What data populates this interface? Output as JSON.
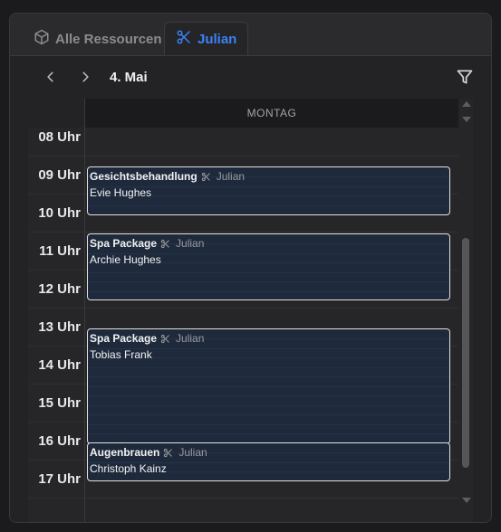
{
  "tabs": [
    {
      "label": "Alle Ressourcen",
      "icon": "cube-icon",
      "active": false
    },
    {
      "label": "Julian",
      "icon": "scissors-icon",
      "active": true
    }
  ],
  "toolbar": {
    "prev_icon": "chevron-left-icon",
    "next_icon": "chevron-right-icon",
    "date": "4. Mai",
    "filter_icon": "filter-icon"
  },
  "calendar": {
    "day_header": "MONTAG",
    "hours": [
      "08 Uhr",
      "09 Uhr",
      "10 Uhr",
      "11 Uhr",
      "12 Uhr",
      "13 Uhr",
      "14 Uhr",
      "15 Uhr",
      "16 Uhr",
      "17 Uhr"
    ],
    "events": [
      {
        "service": "Gesichtsbehandlung",
        "resource": "Julian",
        "client": "Evie Hughes"
      },
      {
        "service": "Spa Package",
        "resource": "Julian",
        "client": "Archie Hughes"
      },
      {
        "service": "Spa Package",
        "resource": "Julian",
        "client": "Tobias Frank"
      },
      {
        "service": "Augenbrauen",
        "resource": "Julian",
        "client": "Christoph Kainz"
      }
    ]
  },
  "colors": {
    "accent": "#3b82f6",
    "background": "#232325",
    "event_fill": "#1e2a3c",
    "event_border": "#e2e2e2"
  }
}
